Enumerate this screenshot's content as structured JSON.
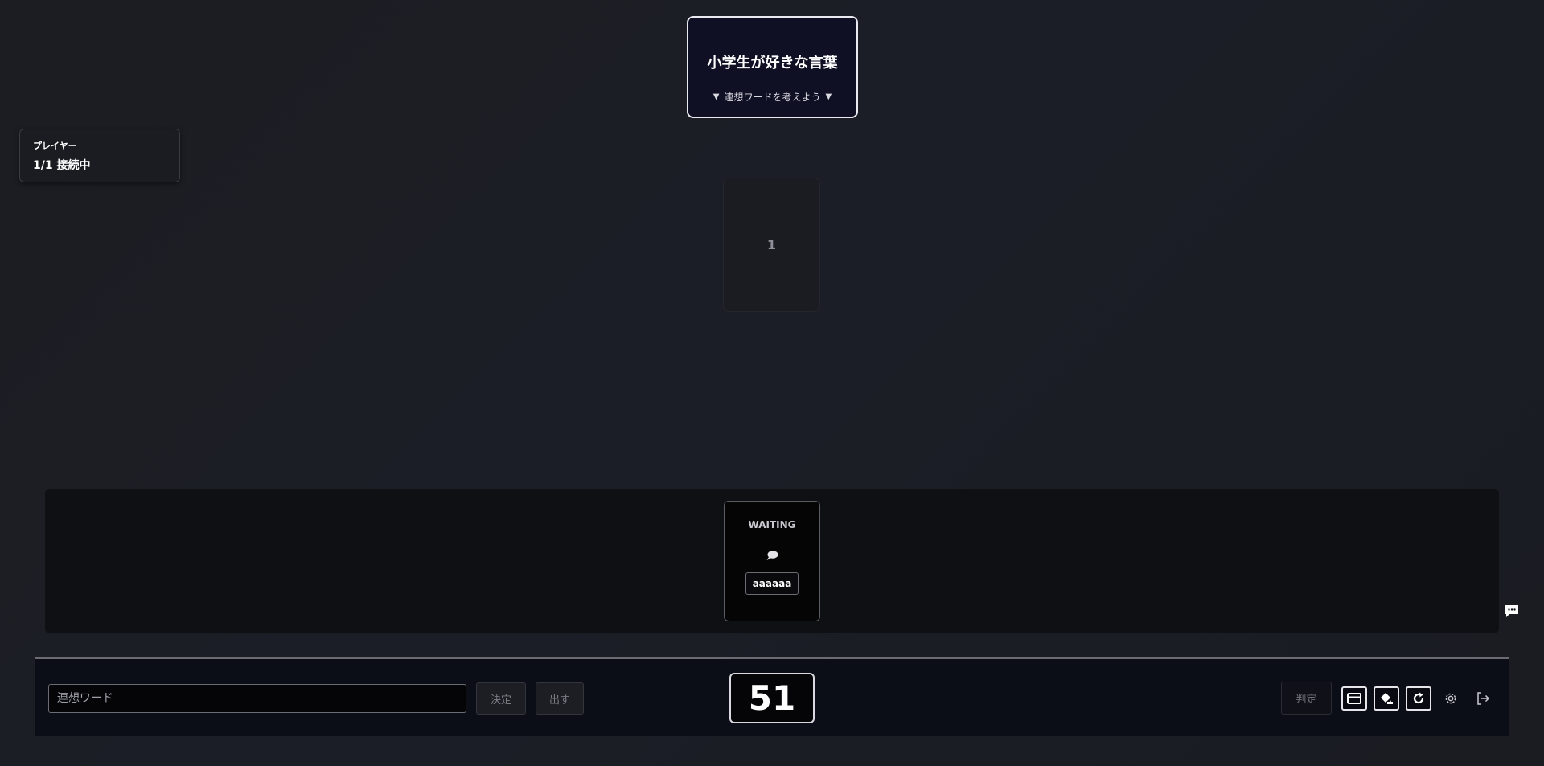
{
  "theme": {
    "title": "小学生が好きな言葉",
    "hint": "連想ワードを考えよう",
    "hint_marker": "▼"
  },
  "players": {
    "label": "プレイヤー",
    "status": "1/1 接続中"
  },
  "slot": {
    "number": "1"
  },
  "hand": {
    "status": "WAITING",
    "player_name": "aaaaaa",
    "icon": "speech-bubble-icon"
  },
  "controls": {
    "word_input_placeholder": "連想ワード",
    "word_input_value": "",
    "decide_label": "決定",
    "play_label": "出す",
    "timer": "51",
    "judge_label": "判定",
    "icons": [
      "card-icon",
      "paint-bucket-icon",
      "refresh-icon",
      "gear-icon",
      "logout-icon"
    ]
  },
  "chat": {
    "icon": "chat-icon"
  },
  "colors": {
    "background": "#1c1d22",
    "theme_card_bg": "#0f1023",
    "bottom_bar_bg": "#0c0e17",
    "accent_white": "#ffffff"
  }
}
